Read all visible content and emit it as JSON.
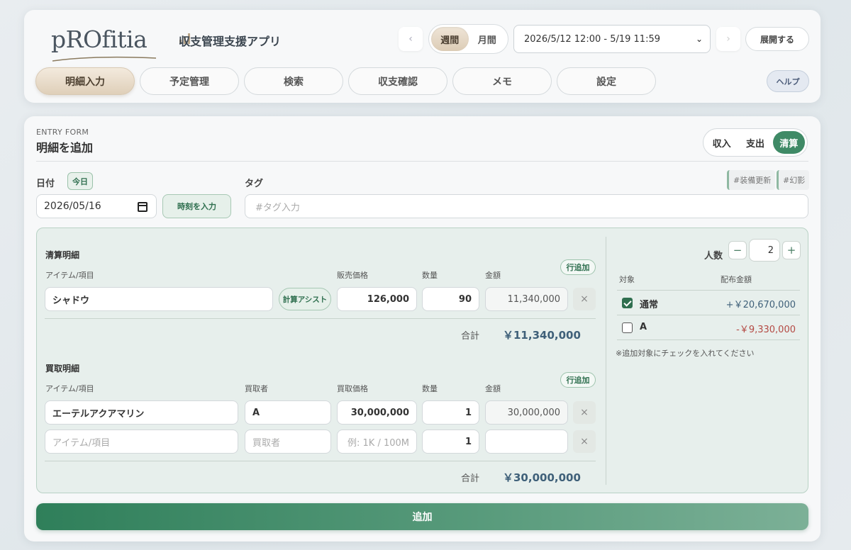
{
  "header": {
    "logo_text": "pROfitia",
    "app_title": "収支管理支援アプリ",
    "prev_arrow": "‹",
    "next_arrow": "›",
    "period_tabs": [
      {
        "label": "週間",
        "active": true
      },
      {
        "label": "月間",
        "active": false
      }
    ],
    "range_value": "2026/5/12 12:00 - 5/19 11:59",
    "expand_label": "展開する",
    "help_label": "ヘルプ"
  },
  "nav": {
    "tabs": [
      {
        "label": "明細入力",
        "active": true
      },
      {
        "label": "予定管理",
        "active": false
      },
      {
        "label": "検索",
        "active": false
      },
      {
        "label": "収支確認",
        "active": false
      },
      {
        "label": "メモ",
        "active": false
      },
      {
        "label": "設定",
        "active": false
      }
    ]
  },
  "form": {
    "entry_label": "ENTRY FORM",
    "title": "明細を追加",
    "type_options": [
      {
        "label": "収入",
        "active": false
      },
      {
        "label": "支出",
        "active": false
      },
      {
        "label": "清算",
        "active": true
      }
    ],
    "date_label": "日付",
    "today_label": "今日",
    "date_value": "2026/05/16",
    "time_button": "時刻を入力",
    "tag_label": "タグ",
    "tag_placeholder": "#タグ入力",
    "tag_chips": [
      "#装備更新",
      "#幻影"
    ],
    "submit_label": "追加"
  },
  "settlement": {
    "title": "清算明細",
    "row_add": "行追加",
    "columns": {
      "item": "アイテム/項目",
      "price": "販売価格",
      "qty": "数量",
      "amount": "金額"
    },
    "rows": [
      {
        "item": "シャドウ",
        "assist": "計算アシスト",
        "price": "126,000",
        "qty": "90",
        "amount": "11,340,000",
        "delete": "×"
      }
    ],
    "sum_label": "合計",
    "sum_value": "￥11,340,000"
  },
  "purchase": {
    "title": "買取明細",
    "row_add": "行追加",
    "columns": {
      "item": "アイテム/項目",
      "buyer": "買取者",
      "price": "買取価格",
      "qty": "数量",
      "amount": "金額"
    },
    "rows": [
      {
        "item": "エーテルアクアマリン",
        "buyer": "A",
        "price": "30,000,000",
        "qty": "1",
        "amount": "30,000,000",
        "delete": "×"
      }
    ],
    "empty_row": {
      "item_placeholder": "アイテム/項目",
      "buyer_placeholder": "買取者",
      "price_placeholder": "例: 1K / 100M",
      "qty": "1",
      "delete": "×"
    },
    "sum_label": "合計",
    "sum_value": "￥30,000,000"
  },
  "distribution": {
    "people_label": "人数",
    "minus": "−",
    "plus": "+",
    "people_value": "2",
    "col_target": "対象",
    "col_amount": "配布金額",
    "rows": [
      {
        "name": "通常",
        "checked": true,
        "amount": "+￥20,670,000"
      },
      {
        "name": "A",
        "checked": false,
        "amount": "-￥9,330,000"
      }
    ],
    "note": "※追加対象にチェックを入れてください"
  },
  "colors": {
    "accent_green": "#3f8a66",
    "active_tab_beige": "#dfcfb9",
    "positive_amount": "#3f6079",
    "negative_amount": "#b44a44"
  }
}
